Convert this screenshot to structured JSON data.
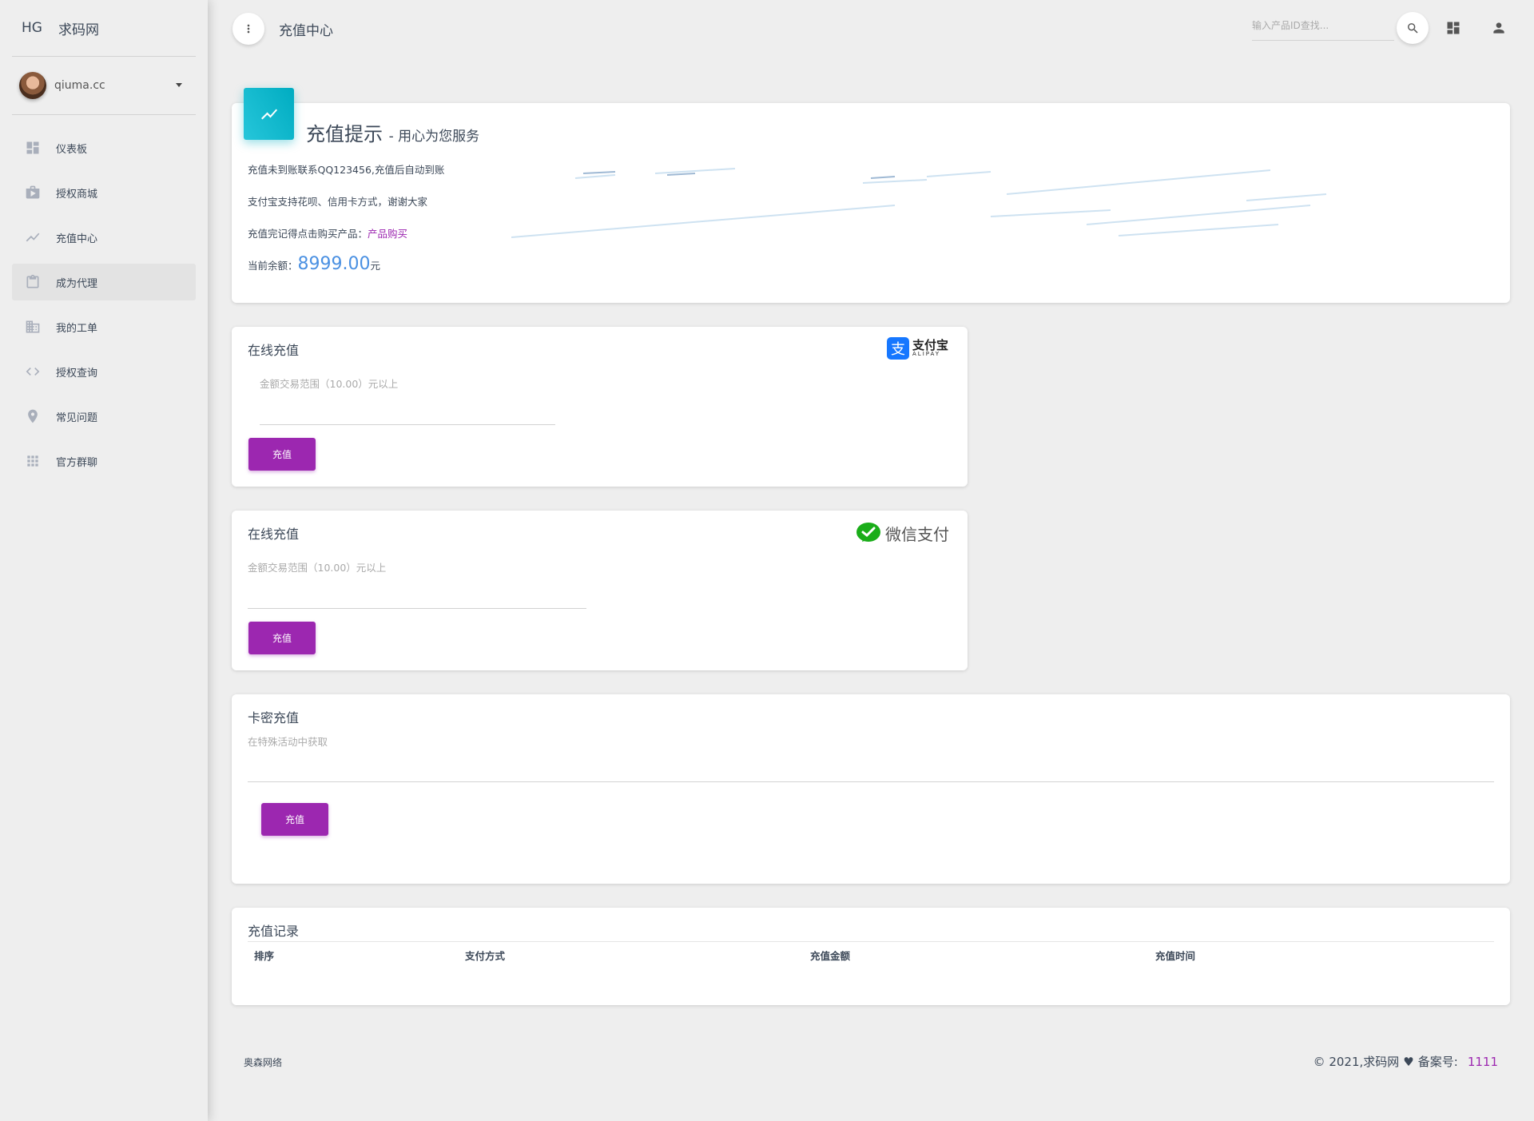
{
  "sidebar": {
    "brand_mini": "HG",
    "brand_name": "求码网",
    "username": "qiuma.cc",
    "items": [
      {
        "label": "仪表板",
        "icon": "dashboard-icon"
      },
      {
        "label": "授权商城",
        "icon": "shop-icon"
      },
      {
        "label": "充值中心",
        "icon": "trending-icon"
      },
      {
        "label": "成为代理",
        "icon": "clipboard-icon"
      },
      {
        "label": "我的工单",
        "icon": "building-icon"
      },
      {
        "label": "授权查询",
        "icon": "code-icon"
      },
      {
        "label": "常见问题",
        "icon": "place-icon"
      },
      {
        "label": "官方群聊",
        "icon": "apps-icon"
      }
    ],
    "active_index": 3
  },
  "header": {
    "title": "充值中心",
    "search_placeholder": "输入产品ID查找..."
  },
  "notice": {
    "title": "充值提示",
    "subtitle": "- 用心为您服务",
    "line1": "充值未到账联系QQ123456,充值后自动到账",
    "line2": "支付宝支持花呗、信用卡方式，谢谢大家",
    "line3_prefix": "充值完记得点击购买产品：",
    "line3_link": "产品购买",
    "balance_label": "当前余额：",
    "balance_value": "8999.00",
    "balance_unit": "元"
  },
  "alipay": {
    "title": "在线充值",
    "logo_text": "支付宝",
    "logo_sub": "ALIPAY",
    "hint": "金额交易范围（10.00）元以上",
    "button": "充值"
  },
  "wechat": {
    "title": "在线充值",
    "logo_text": "微信支付",
    "hint": "金额交易范围（10.00）元以上",
    "button": "充值"
  },
  "card_code": {
    "title": "卡密充值",
    "hint": "在特殊活动中获取",
    "button": "充值"
  },
  "records": {
    "title": "充值记录",
    "columns": [
      "排序",
      "支付方式",
      "充值金额",
      "充值时间"
    ]
  },
  "footer": {
    "left": "奥森网络",
    "copyright": "© 2021,求码网",
    "icp_label": "备案号:",
    "icp_value": "1111"
  },
  "colors": {
    "accent": "#9c27b0",
    "info": "#00acc1",
    "balance": "#4a90e2"
  }
}
